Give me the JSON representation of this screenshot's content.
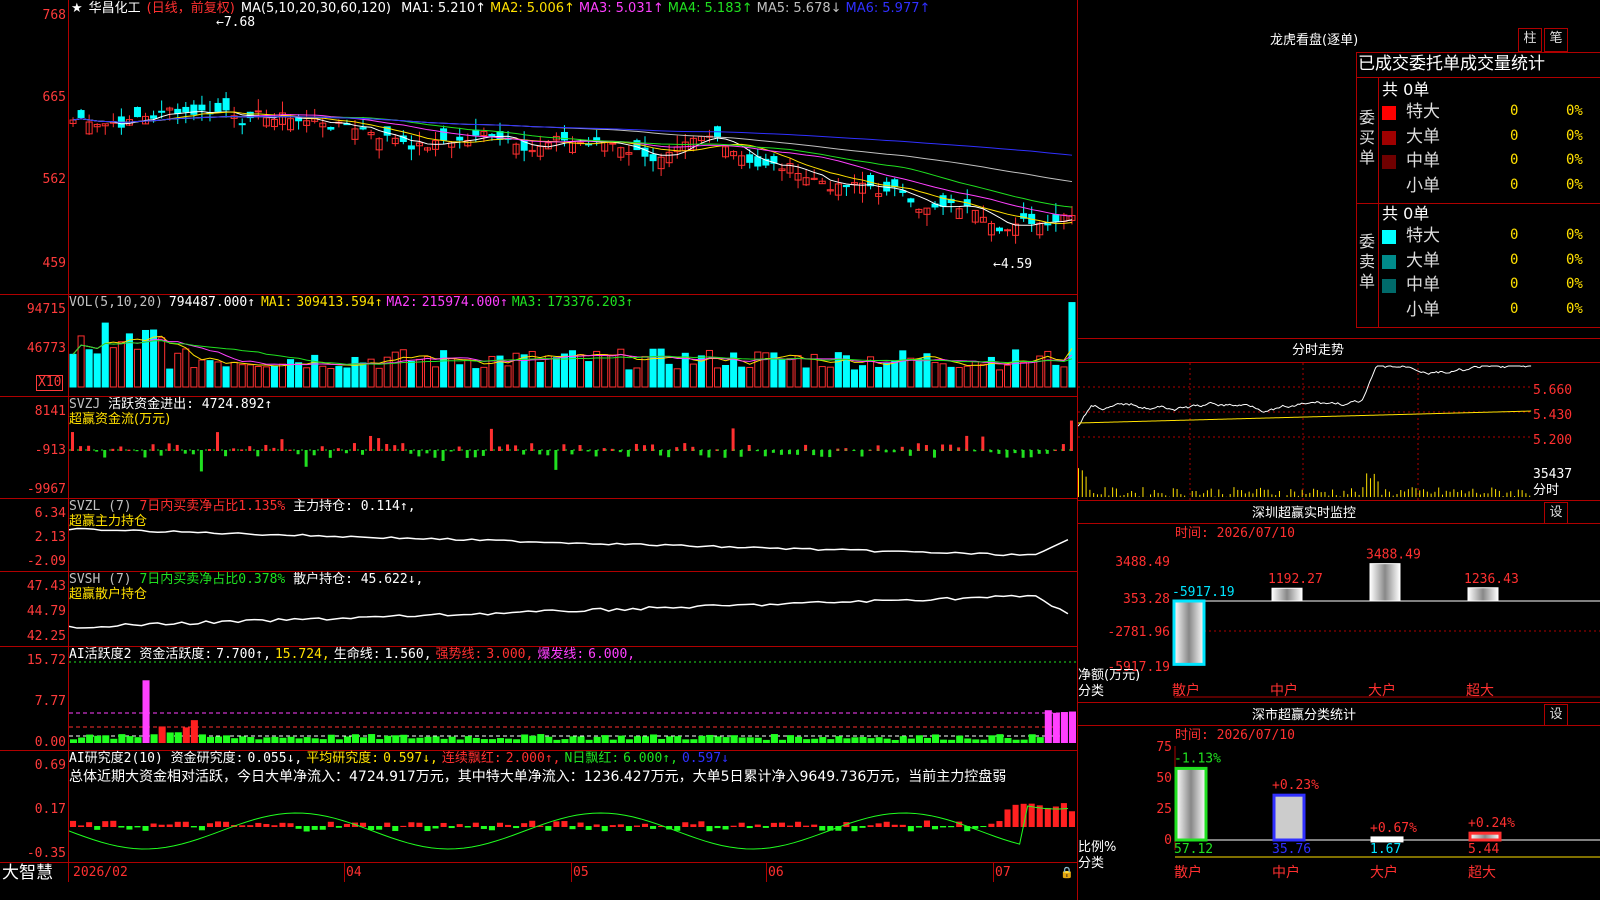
{
  "stock": {
    "star": "★",
    "name": "华昌化工",
    "period": "(日线，前复权)"
  },
  "colors": {
    "up": "#ff3030",
    "down": "#00ffff",
    "ma1": "#ffffff",
    "ma2": "#ffe000",
    "ma3": "#ff40ff",
    "ma4": "#20e020",
    "ma5": "#c0c0c0",
    "ma6": "#3030ff"
  },
  "kline": {
    "indicator": "MA(5,10,20,30,60,120)",
    "ma": [
      {
        "label": "MA1:",
        "value": "5.210↑",
        "color": "#ffffff"
      },
      {
        "label": "MA2:",
        "value": "5.006↑",
        "color": "#ffe000"
      },
      {
        "label": "MA3:",
        "value": "5.031↑",
        "color": "#ff40ff"
      },
      {
        "label": "MA4:",
        "value": "5.183↑",
        "color": "#20e020"
      },
      {
        "label": "MA5:",
        "value": "5.678↓",
        "color": "#c0c0c0"
      },
      {
        "label": "MA6:",
        "value": "5.977↑",
        "color": "#3030ff"
      }
    ],
    "yaxis": [
      "768",
      "665",
      "562",
      "459"
    ],
    "high_mark": "7.68",
    "low_mark": "4.59"
  },
  "vol": {
    "indicator": "VOL(5,10,20)",
    "value": "794487.000↑",
    "ma": [
      {
        "label": "MA1:",
        "value": "309413.594↑",
        "color": "#ffe000"
      },
      {
        "label": "MA2:",
        "value": "215974.000↑",
        "color": "#ff40ff"
      },
      {
        "label": "MA3:",
        "value": "173376.203↑",
        "color": "#20e020"
      }
    ],
    "yaxis": [
      "94715",
      "46773"
    ],
    "unit": "X10"
  },
  "svzj": {
    "name": "SVZJ",
    "label": "活跃资金进出:",
    "value": "4724.892↑",
    "sub": "超赢资金流(万元)",
    "yaxis": [
      "8141",
      "-913",
      "-9967"
    ]
  },
  "svzl": {
    "name": "SVZL (7)",
    "label1": "7日内买卖净占比1.135%",
    "label2": "主力持仓:",
    "value": "0.114↑,",
    "sub": "超赢主力持仓",
    "yaxis": [
      "6.34",
      "2.13",
      "-2.09"
    ]
  },
  "svsh": {
    "name": "SVSH (7)",
    "label1": "7日内买卖净占比0.378%",
    "label2": "散户持仓:",
    "value": "45.622↓,",
    "sub": "超赢散户持仓",
    "yaxis": [
      "47.43",
      "44.79",
      "42.25"
    ]
  },
  "ai1": {
    "name": "AI活跃度2",
    "items": [
      {
        "text": "资金活跃度:",
        "color": "#ffffff"
      },
      {
        "text": "7.700↑,",
        "color": "#ffffff"
      },
      {
        "text": "15.724,",
        "color": "#ffe000"
      },
      {
        "text": "生命线:",
        "color": "#ffffff"
      },
      {
        "text": "1.560,",
        "color": "#ffffff"
      },
      {
        "text": "强势线:",
        "color": "#ff3030"
      },
      {
        "text": "3.000,",
        "color": "#ff3030"
      },
      {
        "text": "爆发线:",
        "color": "#ff40ff"
      },
      {
        "text": "6.000,",
        "color": "#ff40ff"
      }
    ],
    "yaxis": [
      "15.72",
      "7.77",
      "0.00"
    ]
  },
  "ai2": {
    "name": "AI研究度2(10)",
    "items": [
      {
        "text": "资金研究度:",
        "color": "#ffffff"
      },
      {
        "text": "0.055↓,",
        "color": "#ffffff"
      },
      {
        "text": "平均研究度:",
        "color": "#ffe000"
      },
      {
        "text": "0.597↓,",
        "color": "#ffe000"
      },
      {
        "text": "连续飘红:",
        "color": "#ff3030"
      },
      {
        "text": "2.000↑,",
        "color": "#ff3030"
      },
      {
        "text": "N日飘红:",
        "color": "#20e020"
      },
      {
        "text": "6.000↑,",
        "color": "#20e020"
      },
      {
        "text": "0.597↓",
        "color": "#3030ff"
      }
    ],
    "summary": "总体近期大资金相对活跃，今日大单净流入：4724.917万元，其中特大单净流入：1236.427万元，大单5日累计净入9649.736万元，当前主力控盘弱",
    "yaxis": [
      "0.69",
      "0.17",
      "-0.35"
    ]
  },
  "xaxis": {
    "brand": "大智慧",
    "labels": [
      "2026/02",
      "04",
      "05",
      "06",
      "07"
    ]
  },
  "right": {
    "lhb": {
      "title": "龙虎看盘(逐单)",
      "btn1": "柱",
      "btn2": "笔",
      "subtitle": "已成交委托单成交量统计",
      "buy": {
        "side": "委买单",
        "total": "共 0单",
        "rows": [
          {
            "name": "特大",
            "v": "0",
            "p": "0%",
            "c": "#ff0000"
          },
          {
            "name": "大单",
            "v": "0",
            "p": "0%",
            "c": "#a00000"
          },
          {
            "name": "中单",
            "v": "0",
            "p": "0%",
            "c": "#700000"
          },
          {
            "name": "小单",
            "v": "0",
            "p": "0%",
            "c": "#000000"
          }
        ]
      },
      "sell": {
        "side": "委卖单",
        "total": "共 0单",
        "rows": [
          {
            "name": "特大",
            "v": "0",
            "p": "0%",
            "c": "#00ffff"
          },
          {
            "name": "大单",
            "v": "0",
            "p": "0%",
            "c": "#008b8b"
          },
          {
            "name": "中单",
            "v": "0",
            "p": "0%",
            "c": "#006a6a"
          },
          {
            "name": "小单",
            "v": "0",
            "p": "0%",
            "c": "#000000"
          }
        ]
      }
    },
    "fenshi": {
      "title": "分时走势",
      "yaxis": [
        "5.660",
        "5.430",
        "5.200"
      ],
      "vol": "35437",
      "vol_label": "分时"
    },
    "monitor": {
      "title": "深圳超赢实时监控",
      "set": "设",
      "time": "时间: 2026/07/10",
      "yaxis": [
        "3488.49",
        "353.28",
        "-2781.96",
        "-5917.19"
      ],
      "values": [
        "-5917.19",
        "1192.27",
        "3488.49",
        "1236.43"
      ],
      "unit1": "净额(万元)",
      "unit2": "分类",
      "cats": [
        "散户",
        "中户",
        "大户",
        "超大"
      ]
    },
    "classify": {
      "title": "深市超赢分类统计",
      "set": "设",
      "time": "时间: 2026/07/10",
      "yaxis": [
        "75",
        "50",
        "25",
        "0"
      ],
      "top": [
        "-1.13%",
        "+0.23%",
        "+0.67%",
        "+0.24%"
      ],
      "bottom": [
        "57.12",
        "35.76",
        "1.67",
        "5.44"
      ],
      "unit1": "比例%",
      "unit2": "分类",
      "cats": [
        "散户",
        "中户",
        "大户",
        "超大"
      ]
    }
  }
}
